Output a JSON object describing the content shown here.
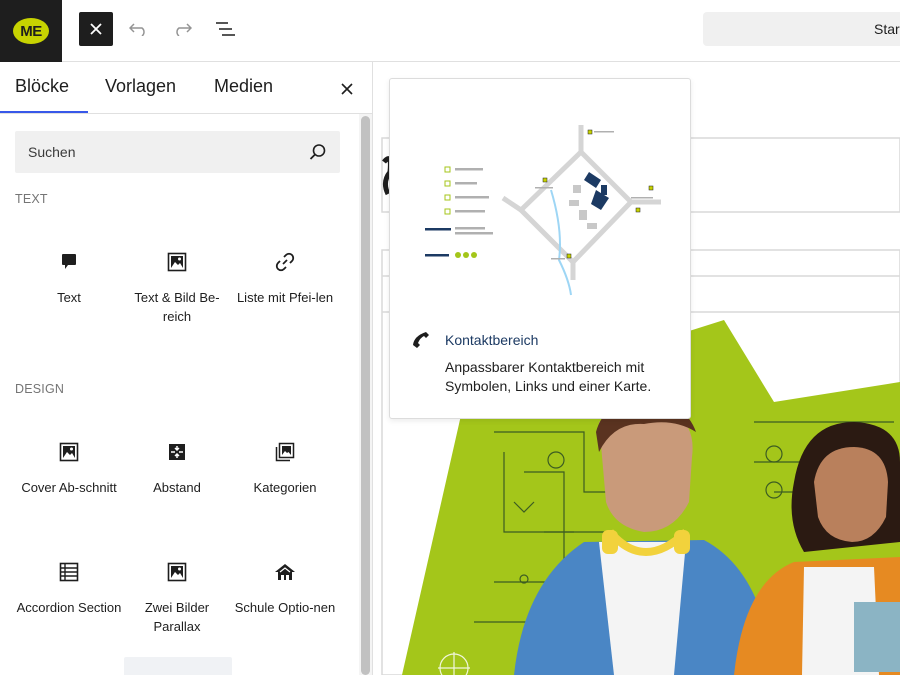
{
  "topbar": {
    "logo_text": "ME",
    "doc_title": "Star",
    "close_icon": "close-icon",
    "undo_icon": "undo-icon",
    "redo_icon": "redo-icon",
    "list_icon": "list-view-icon"
  },
  "sidebar": {
    "tabs": [
      {
        "label": "Blöcke"
      },
      {
        "label": "Vorlagen"
      },
      {
        "label": "Medien"
      }
    ],
    "search": {
      "placeholder": "Suchen"
    },
    "sections": [
      {
        "label": "Text"
      },
      {
        "label": "Design"
      }
    ],
    "blocks": [
      {
        "label": "Text",
        "icon": "speech-bubble-icon"
      },
      {
        "label": "Text & Bild Be-reich",
        "icon": "image-icon"
      },
      {
        "label": "Liste mit Pfei-len",
        "icon": "link-icon"
      },
      {
        "label": "Cover Ab-schnitt",
        "icon": "image-icon"
      },
      {
        "label": "Abstand",
        "icon": "spacer-icon"
      },
      {
        "label": "Kategorien",
        "icon": "gallery-icon"
      },
      {
        "label": "Accordion Section",
        "icon": "table-list-icon"
      },
      {
        "label": "Zwei Bilder Parallax",
        "icon": "image-icon"
      },
      {
        "label": "Schule Optio-nen",
        "icon": "school-icon"
      }
    ]
  },
  "popover": {
    "title": "Kontaktbereich",
    "description": "Anpassbarer Kontaktbereich mit Symbolen, Links und einer Karte.",
    "icon": "phone-icon"
  },
  "colors": {
    "accent": "#3858e9",
    "brand_green": "#a4c61a",
    "logo_green": "#c7d301",
    "dark": "#1e1e1e",
    "navy": "#1c3a63"
  }
}
